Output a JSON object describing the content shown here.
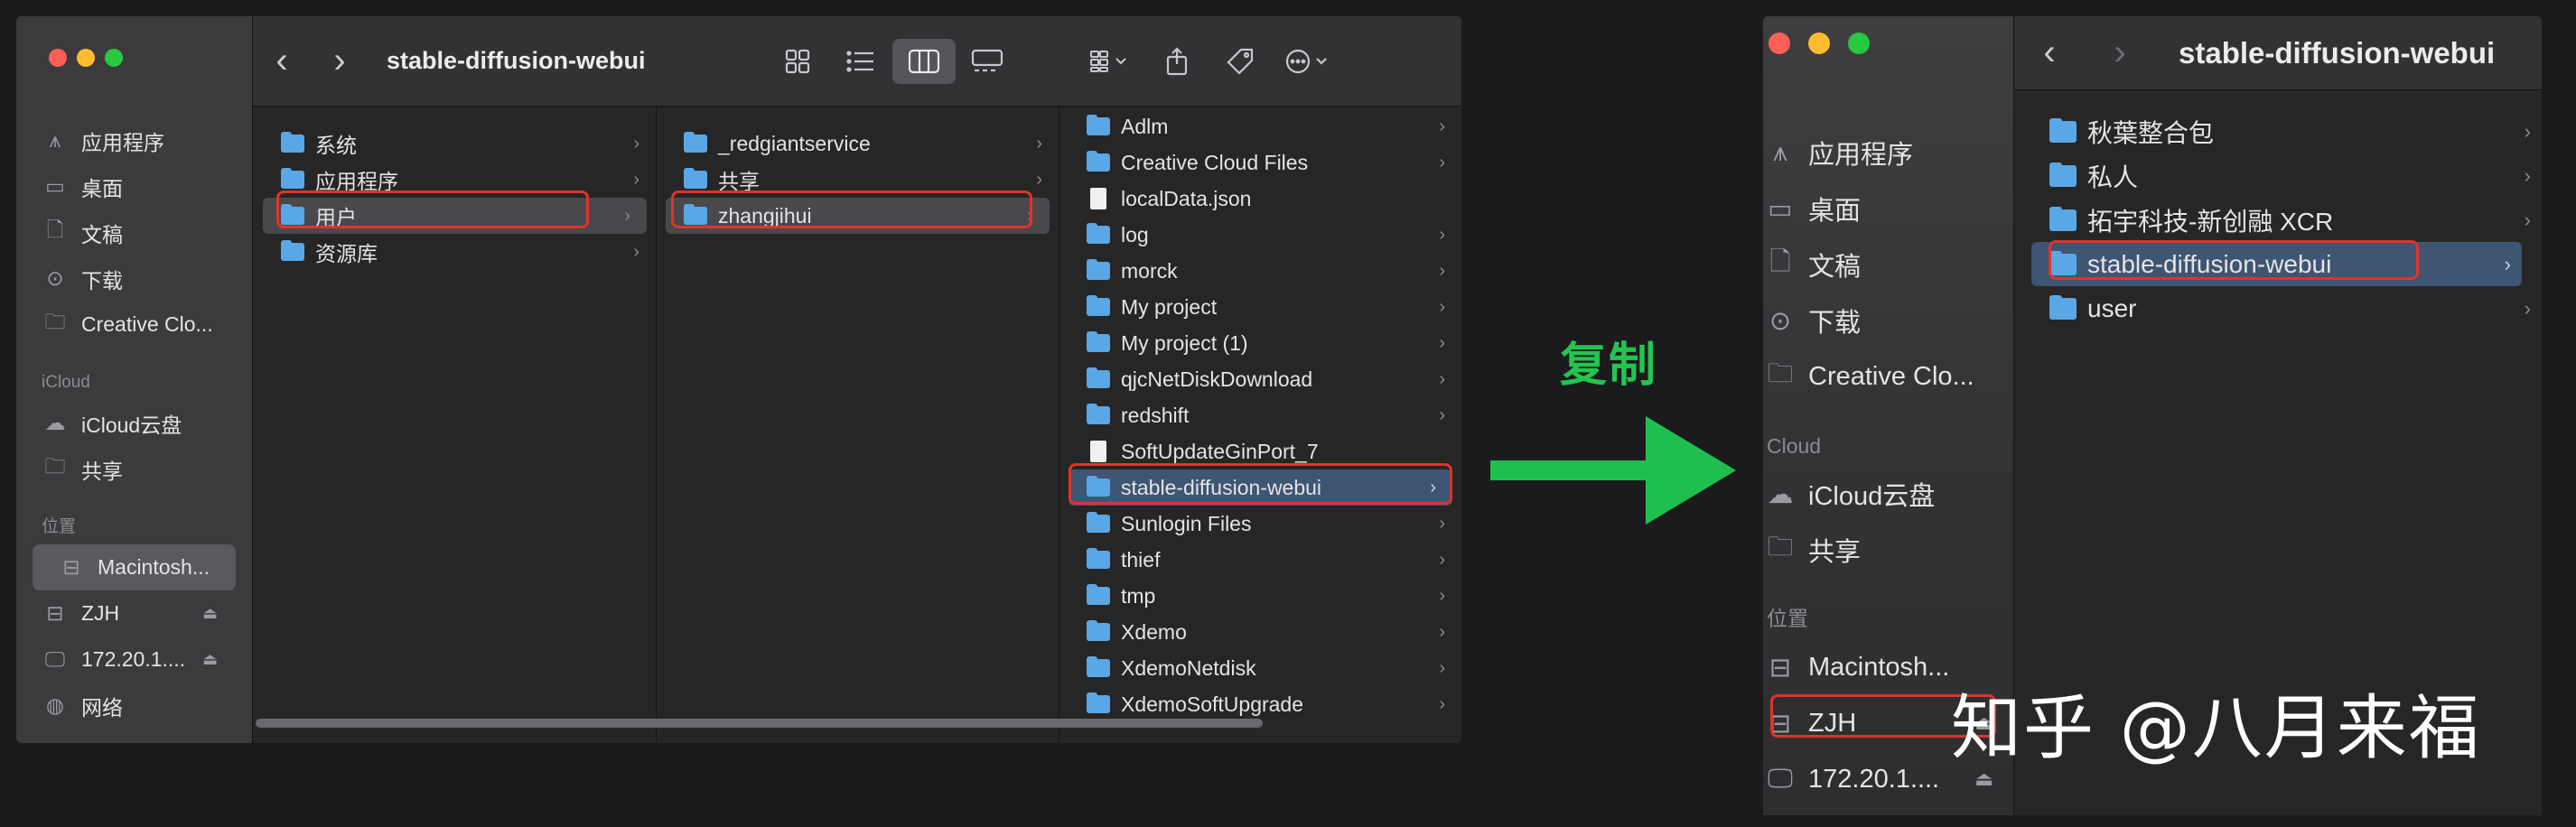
{
  "left_window": {
    "title": "stable-diffusion-webui",
    "sidebar": {
      "items": [
        {
          "label": "应用程序",
          "icon": "apps-icon",
          "glyph": "⩚"
        },
        {
          "label": "桌面",
          "icon": "desktop-icon",
          "glyph": "▭"
        },
        {
          "label": "文稿",
          "icon": "document-icon",
          "glyph": "🗋"
        },
        {
          "label": "下载",
          "icon": "download-icon",
          "glyph": "⊙"
        },
        {
          "label": "Creative Clo...",
          "icon": "folder-icon",
          "glyph": "🗀"
        }
      ],
      "icloud_header": "iCloud",
      "icloud_items": [
        {
          "label": "iCloud云盘",
          "icon": "cloud-icon",
          "glyph": "☁"
        },
        {
          "label": "共享",
          "icon": "shared-folder-icon",
          "glyph": "🗀"
        }
      ],
      "locations_header": "位置",
      "location_items": [
        {
          "label": "Macintosh...",
          "icon": "drive-icon",
          "glyph": "⊟"
        },
        {
          "label": "ZJH",
          "icon": "drive-icon",
          "glyph": "⊟",
          "eject": "⏏"
        },
        {
          "label": "172.20.1....",
          "icon": "monitor-icon",
          "glyph": "🖵",
          "eject": "⏏"
        },
        {
          "label": "网络",
          "icon": "network-icon",
          "glyph": "◍"
        }
      ]
    },
    "columns": [
      [
        "系统",
        "应用程序",
        "用户",
        "资源库"
      ],
      [
        "_redgiantservice",
        "共享",
        "zhangjihui"
      ],
      [
        "Adlm",
        "Creative Cloud Files",
        "localData.json",
        "log",
        "morck",
        "My project",
        "My project (1)",
        "qjcNetDiskDownload",
        "redshift",
        "SoftUpdateGinPort_7",
        "stable-diffusion-webui",
        "Sunlogin Files",
        "thief",
        "tmp",
        "Xdemo",
        "XdemoNetdisk",
        "XdemoSoftUpgrade"
      ]
    ]
  },
  "right_window": {
    "title": "stable-diffusion-webui",
    "sidebar": {
      "items": [
        {
          "label": "应用程序",
          "icon": "apps-icon",
          "glyph": "⩚"
        },
        {
          "label": "桌面",
          "icon": "desktop-icon",
          "glyph": "▭"
        },
        {
          "label": "文稿",
          "icon": "document-icon",
          "glyph": "🗋"
        },
        {
          "label": "下载",
          "icon": "download-icon",
          "glyph": "⊙"
        },
        {
          "label": "Creative Clo...",
          "icon": "folder-icon",
          "glyph": "🗀"
        }
      ],
      "icloud_header": "Cloud",
      "icloud_items": [
        {
          "label": "iCloud云盘",
          "icon": "cloud-icon",
          "glyph": "☁"
        },
        {
          "label": "共享",
          "icon": "shared-folder-icon",
          "glyph": "🗀"
        }
      ],
      "locations_header": "位置",
      "location_items": [
        {
          "label": "Macintosh...",
          "icon": "drive-icon",
          "glyph": "⊟"
        },
        {
          "label": "ZJH",
          "icon": "drive-icon",
          "glyph": "⊟",
          "eject": "⏏"
        },
        {
          "label": "172.20.1....",
          "icon": "monitor-icon",
          "glyph": "🖵",
          "eject": "⏏"
        }
      ]
    },
    "items": [
      "秋葉整合包",
      "私人",
      "拓宇科技-新创融 XCR",
      "stable-diffusion-webui",
      "user"
    ]
  },
  "arrow_label": "复制",
  "watermark": "知乎 @八月来福",
  "colors": {
    "highlight": "#e0332b",
    "arrow": "#1fbf4f",
    "selection": "#3e5573",
    "folder": "#5aa7e6"
  }
}
